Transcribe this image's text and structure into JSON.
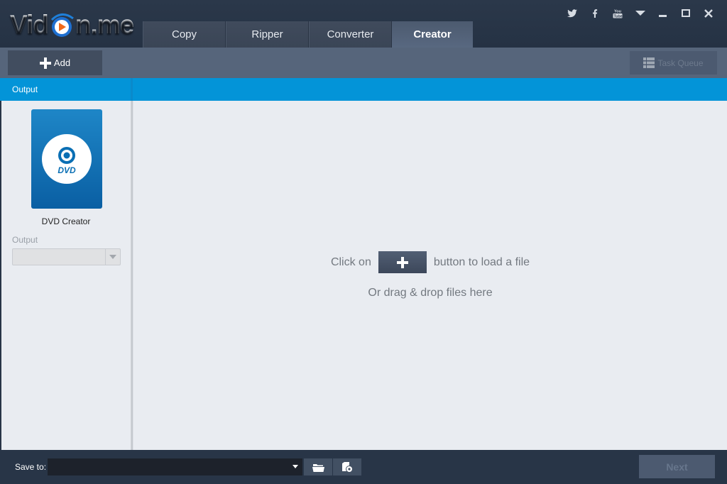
{
  "app": {
    "logo_left": "Vid",
    "logo_right": "n.me"
  },
  "tabs": [
    {
      "label": "Copy",
      "active": false
    },
    {
      "label": "Ripper",
      "active": false
    },
    {
      "label": "Converter",
      "active": false
    },
    {
      "label": "Creator",
      "active": true
    }
  ],
  "window_controls": [
    "twitter-icon",
    "facebook-icon",
    "youtube-icon",
    "menu-dropdown-icon",
    "minimize-icon",
    "maximize-icon",
    "close-icon"
  ],
  "toolbar": {
    "add_label": "Add",
    "task_queue_label": "Task Queue"
  },
  "panel_header": {
    "output_label": "Output"
  },
  "left_panel": {
    "creator_name": "DVD Creator",
    "creator_icon_text": "DVD",
    "output_label": "Output",
    "output_value": ""
  },
  "main": {
    "hint_prefix": "Click on",
    "hint_suffix": "button to load a file",
    "hint_drag": "Or drag & drop files here"
  },
  "bottom": {
    "save_to_label": "Save to:",
    "save_to_value": "",
    "next_label": "Next"
  },
  "colors": {
    "accent_blue": "#0394d8",
    "titlebar": "#283547",
    "toolbar": "#56657b"
  }
}
